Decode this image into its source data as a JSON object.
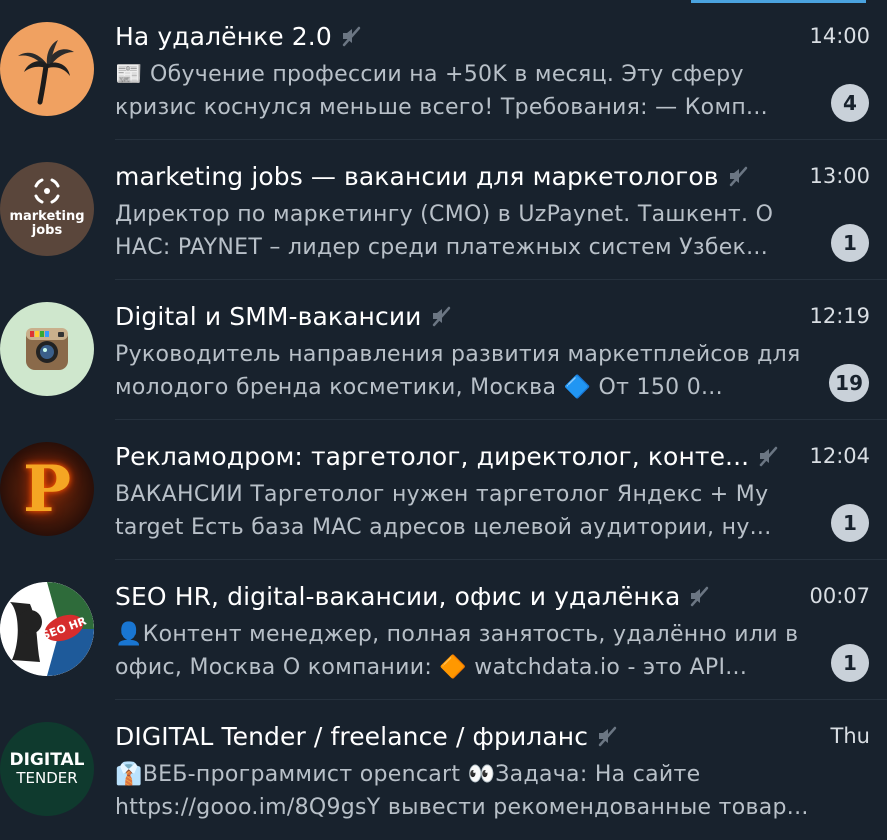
{
  "colors": {
    "background": "#18222d",
    "accent": "#4aa3df",
    "badge": "#c9d1d9",
    "preview_text": "#b8c0c8"
  },
  "chats": [
    {
      "title": "На удалёнке 2.0",
      "muted": true,
      "time": "14:00",
      "preview": "📰 Обучение профессии на +50K в месяц.  Эту сферу кризис коснулся меньше всего!  Требования: — Комп...",
      "unread": "4",
      "avatar": {
        "icon": "palm-tree-icon",
        "bg": "#f0a161"
      }
    },
    {
      "title": "marketing jobs — вакансии для маркетологов",
      "muted": true,
      "time": "13:00",
      "preview": "Директор по маркетингу (CMO) в UzPaynet. Ташкент.  О НАС: PAYNET – лидер среди платежных систем Узбек...",
      "unread": "1",
      "avatar": {
        "icon": "marketing-jobs-logo",
        "bg": "#5a463b",
        "text_line1": "marketing",
        "text_line2": "jobs"
      }
    },
    {
      "title": "Digital и SMM-вакансии",
      "muted": true,
      "time": "12:19",
      "preview": "Руководитель направления развития маркетплейсов для молодого бренда косметики, Москва   🔷 От 150 0...",
      "unread": "19",
      "avatar": {
        "icon": "camera-icon",
        "bg": "#cfe7cd"
      }
    },
    {
      "title": "Рекламодром: таргетолог, директолог, конте...",
      "muted": true,
      "time": "12:04",
      "preview": "ВАКАНСИИ Таргетолог нужен таргетолог Яндекс + My target Есть база MAC адресов целевой аудитории, ну...",
      "unread": "1",
      "avatar": {
        "icon": "fire-letter-p-logo",
        "bg": "#2a0f08",
        "letter": "P"
      }
    },
    {
      "title": "SEO HR, digital-вакансии, офис и удалёнка",
      "muted": true,
      "time": "00:07",
      "preview": "👤Контент менеджер, полная занятость, удалённо или в офис, Москва  О компании:  🔶 watchdata.io - это API...",
      "unread": "1",
      "avatar": {
        "icon": "seo-hr-logo",
        "bg": "#ffffff",
        "text": "SEO HR"
      }
    },
    {
      "title": "DIGITAL Tender / freelance / фриланс",
      "muted": true,
      "time": "Thu",
      "preview": "👔ВЕБ-программист opencart  👀Задача: На сайте https://gooo.im/8Q9gsY вывести рекомендованные товар...",
      "unread": "",
      "avatar": {
        "icon": "digital-tender-logo",
        "bg": "#0f3a2e",
        "text_line1": "DIGITAL",
        "text_line2": "TENDER"
      }
    }
  ]
}
